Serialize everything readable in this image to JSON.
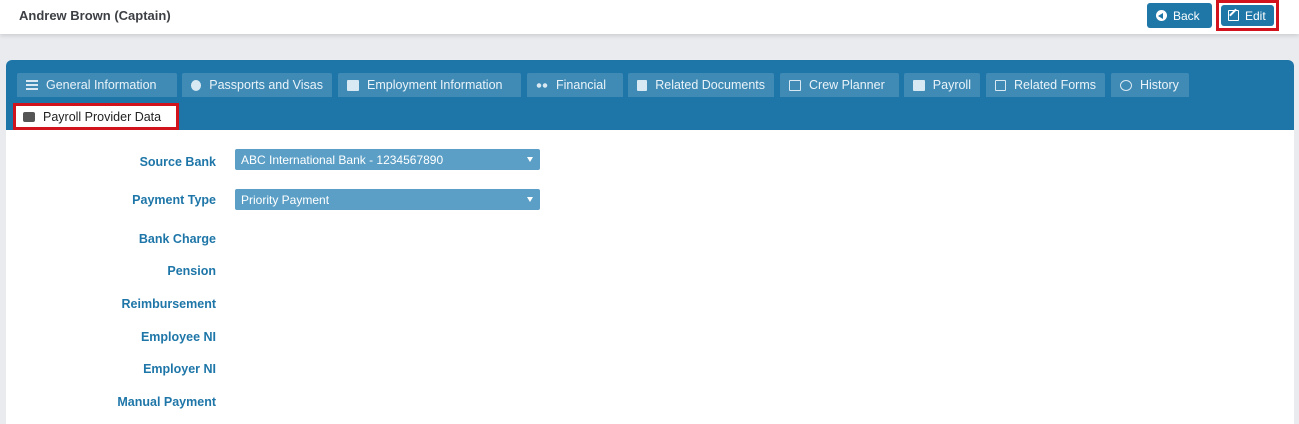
{
  "header": {
    "title": "Andrew Brown (Captain)",
    "back_label": "Back",
    "edit_label": "Edit"
  },
  "tabs": [
    {
      "label": "General Information",
      "icon": "list-icon"
    },
    {
      "label": "Passports and Visas",
      "icon": "passport-icon"
    },
    {
      "label": "Employment Information",
      "icon": "document-icon"
    },
    {
      "label": "Financial",
      "icon": "money-icon"
    },
    {
      "label": "Related Documents",
      "icon": "document-icon"
    },
    {
      "label": "Crew Planner",
      "icon": "calendar-icon"
    },
    {
      "label": "Payroll",
      "icon": "payroll-icon"
    },
    {
      "label": "Related Forms",
      "icon": "form-icon"
    },
    {
      "label": "History",
      "icon": "clock-icon"
    }
  ],
  "active_tab": {
    "label": "Payroll Provider Data",
    "icon": "payroll-provider-icon"
  },
  "form": {
    "source_bank": {
      "label": "Source Bank",
      "value": "ABC International Bank - 1234567890"
    },
    "payment_type": {
      "label": "Payment Type",
      "value": "Priority Payment"
    },
    "bank_charge": {
      "label": "Bank Charge"
    },
    "pension": {
      "label": "Pension"
    },
    "reimbursement": {
      "label": "Reimbursement"
    },
    "employee_ni": {
      "label": "Employee NI"
    },
    "employer_ni": {
      "label": "Employer NI"
    },
    "manual_payment": {
      "label": "Manual Payment"
    }
  },
  "colors": {
    "accent": "#1e76a8",
    "highlight": "#d0131c"
  }
}
